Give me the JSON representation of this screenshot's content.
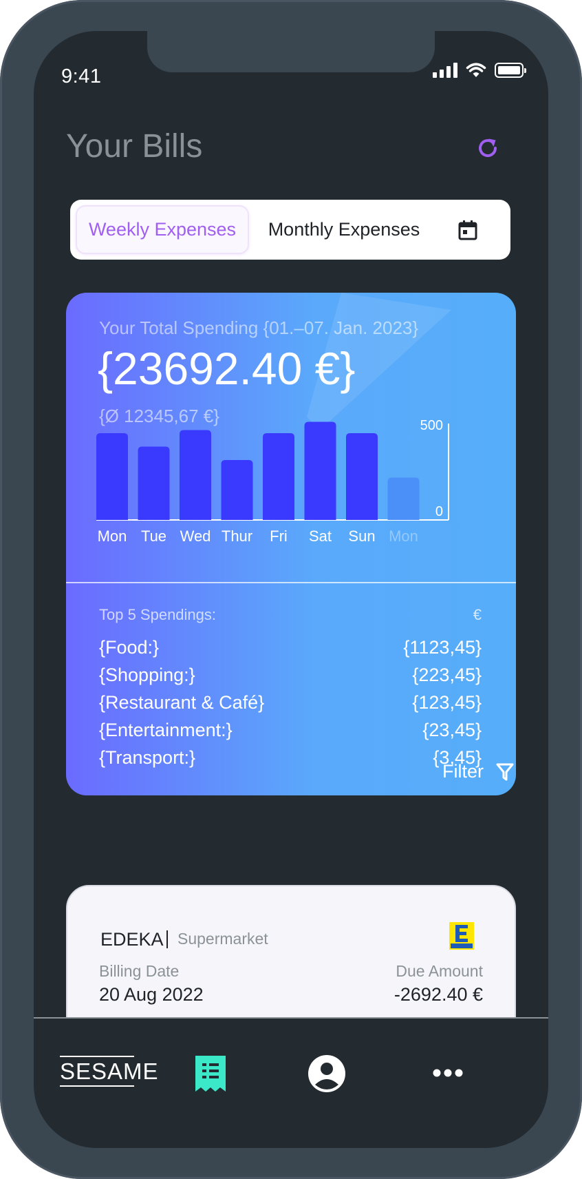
{
  "status_bar": {
    "time": "9:41"
  },
  "header": {
    "title": "Your Bills"
  },
  "tabs": {
    "weekly": "Weekly Expenses",
    "monthly": "Monthly Expenses"
  },
  "spending": {
    "label": "Your Total Spending {01.–07. Jan. 2023}",
    "total": "{23692.40 €}",
    "average": "{Ø 12345,67 €}"
  },
  "chart_data": {
    "type": "bar",
    "categories": [
      "Mon",
      "Tue",
      "Wed",
      "Thur",
      "Fri",
      "Sat",
      "Sun",
      "Mon"
    ],
    "values": [
      420,
      355,
      435,
      290,
      420,
      475,
      420,
      205
    ],
    "yticks": [
      "500",
      "0"
    ],
    "ylim": [
      0,
      500
    ],
    "bar_color": "#3a3aff",
    "future_bar_color": "#4a90f8"
  },
  "top_spendings": {
    "header": "Top 5 Spendings:",
    "currency": "€",
    "items": [
      {
        "label": "{Food:}",
        "value": "{1123,45}"
      },
      {
        "label": "{Shopping:}",
        "value": "{223,45}"
      },
      {
        "label": "{Restaurant & Café}",
        "value": "{123,45}"
      },
      {
        "label": "{Entertainment:}",
        "value": "{23,45}"
      },
      {
        "label": "{Transport:}",
        "value": "{3,45}"
      }
    ]
  },
  "filter": {
    "label": "Filter"
  },
  "bill": {
    "merchant": "EDEKA",
    "category": "Supermarket",
    "logo_text": "EDEKA",
    "billing_date_label": "Billing Date",
    "billing_date": "20 Aug 2022",
    "due_amount_label": "Due Amount",
    "due_amount": "-2692.40 €"
  },
  "nav": {
    "brand": "SESAME"
  },
  "colors": {
    "accent": "#a05ff0",
    "nav_active": "#3be8c8",
    "background": "#232b30"
  },
  "icons": [
    "refresh-icon",
    "calendar-icon",
    "filter-icon",
    "receipt-icon",
    "user-icon",
    "more-icon"
  ]
}
